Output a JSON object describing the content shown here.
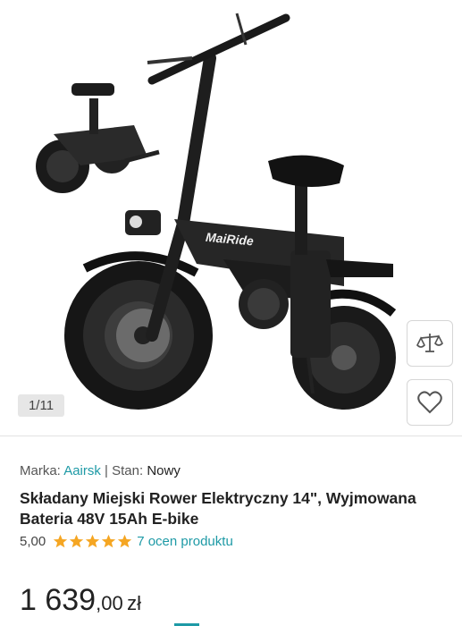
{
  "gallery": {
    "counter": "1/11",
    "brand_logo": "MaiRide"
  },
  "product": {
    "brand_label": "Marka:",
    "brand": "Aairsk",
    "separator": "|",
    "condition_label": "Stan:",
    "condition": "Nowy",
    "title": "Składany Miejski Rower Elektryczny 14\", Wyjmowana Bateria 48V 15Ah E-bike",
    "rating": "5,00",
    "stars": 5,
    "reviews": "7 ocen produktu",
    "price_int": "1 639",
    "price_frac": ",00",
    "currency": "zł"
  },
  "icons": {
    "compare": "scales-icon",
    "favorite": "heart-icon",
    "star": "star-icon"
  },
  "colors": {
    "link": "#1e9aa6",
    "star": "#f5a623",
    "text": "#222222"
  }
}
